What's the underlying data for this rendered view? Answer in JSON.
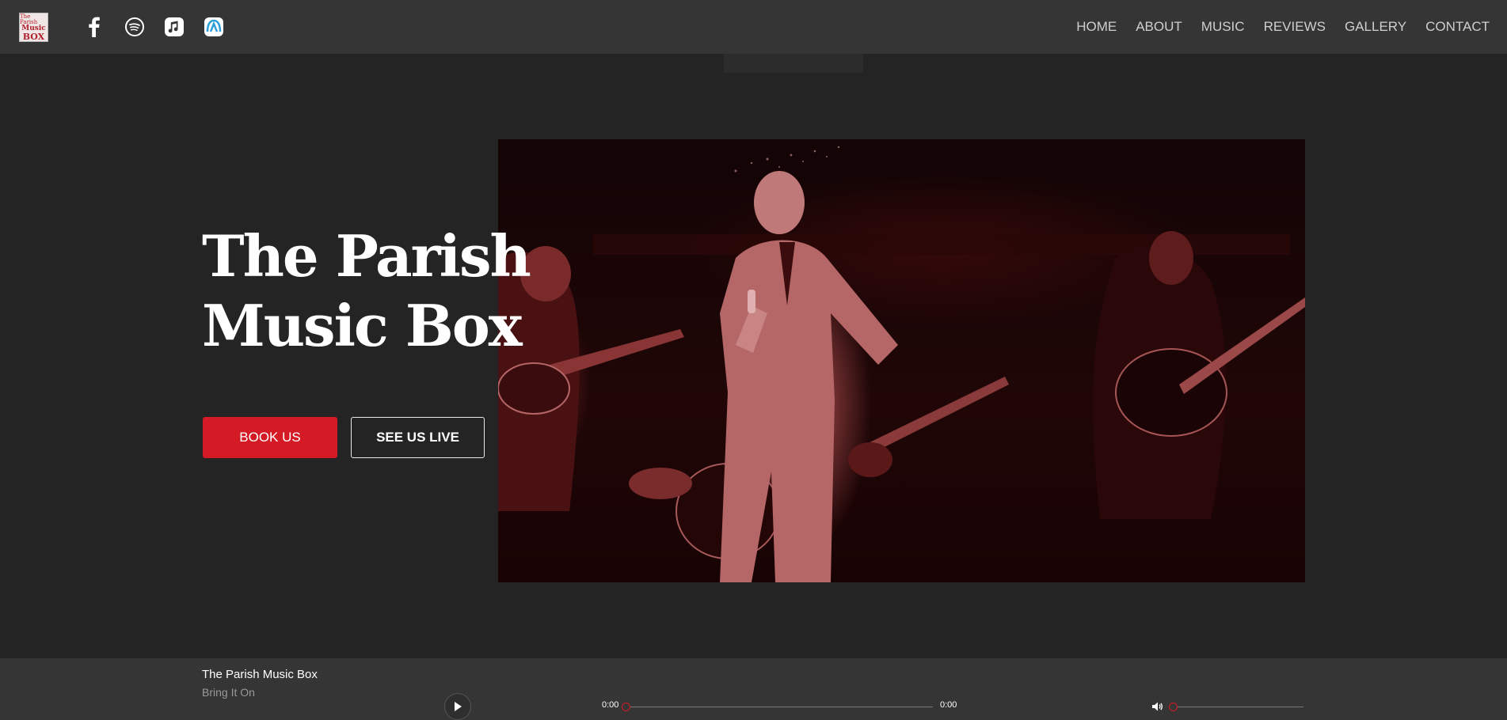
{
  "logo": {
    "line1": "The Parish",
    "line2": "Music",
    "line3": "BOX"
  },
  "social": [
    "facebook-icon",
    "spotify-icon",
    "apple-music-icon",
    "audiomack-icon"
  ],
  "nav": {
    "items": [
      "HOME",
      "ABOUT",
      "MUSIC",
      "REVIEWS",
      "GALLERY",
      "CONTACT"
    ]
  },
  "hero": {
    "title_line1": "The Parish",
    "title_line2": "Music Box",
    "book_label": "BOOK US",
    "live_label": "SEE US LIVE"
  },
  "player": {
    "artist": "The Parish Music Box",
    "track": "Bring It On",
    "current_time": "0:00",
    "duration": "0:00",
    "progress": 0,
    "volume": 0
  },
  "colors": {
    "accent": "#d41b25",
    "background": "#242424",
    "bar": "#353535"
  }
}
